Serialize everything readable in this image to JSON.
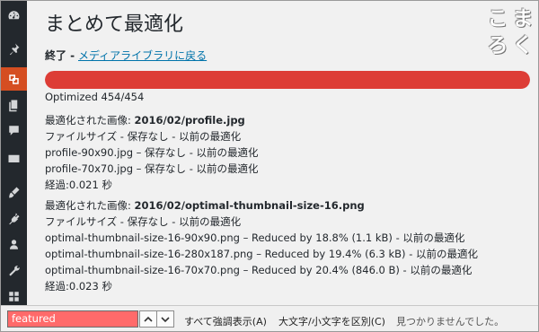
{
  "page": {
    "title": "まとめて最適化",
    "status_prefix": "終了 -",
    "status_link": "メディアライブラリに戻る",
    "progress_fraction": 1.0,
    "optimized_count": "Optimized 454/454"
  },
  "logo": [
    "こ",
    "ま",
    "ろ",
    "く"
  ],
  "blocks": [
    {
      "image_label": "最適化された画像:",
      "image_name": "2016/02/profile.jpg",
      "lines": [
        "ファイルサイズ - 保存なし - 以前の最適化",
        "profile-90x90.jpg – 保存なし - 以前の最適化",
        "profile-70x70.jpg – 保存なし - 以前の最適化"
      ],
      "elapsed_label": "経過:",
      "elapsed_value": "0.021 秒"
    },
    {
      "image_label": "最適化された画像:",
      "image_name": "2016/02/optimal-thumbnail-size-16.png",
      "lines": [
        "ファイルサイズ - 保存なし - 以前の最適化",
        "optimal-thumbnail-size-16-90x90.png – Reduced by 18.8% (1.1 kB) - 以前の最適化",
        "optimal-thumbnail-size-16-280x187.png – Reduced by 19.4% (6.3 kB) - 以前の最適化",
        "optimal-thumbnail-size-16-70x70.png – Reduced by 20.4% (846.0 B) - 以前の最適化"
      ],
      "elapsed_label": "経過:",
      "elapsed_value": "0.023 秒"
    }
  ],
  "sidebar": {
    "items": [
      {
        "icon": "dashboard-icon"
      },
      {
        "icon": "pin-icon"
      },
      {
        "icon": "media-icon",
        "active": true
      },
      {
        "icon": "pages-icon"
      },
      {
        "icon": "comments-icon"
      },
      {
        "icon": "mail-icon"
      },
      {
        "icon": "appearance-icon"
      },
      {
        "icon": "plugins-icon"
      },
      {
        "icon": "users-icon"
      },
      {
        "icon": "tools-icon"
      },
      {
        "icon": "settings-icon"
      }
    ],
    "active_color": "#d54e21",
    "bg_color": "#23282d"
  },
  "findbar": {
    "query": "featured",
    "highlight_all": "すべて強調表示(A)",
    "match_case": "大文字/小文字を区別(C)",
    "status": "見つかりませんでした。",
    "input_bg": "#ff6a6a"
  },
  "colors": {
    "progress": "#dd3d36",
    "link": "#0073aa"
  }
}
